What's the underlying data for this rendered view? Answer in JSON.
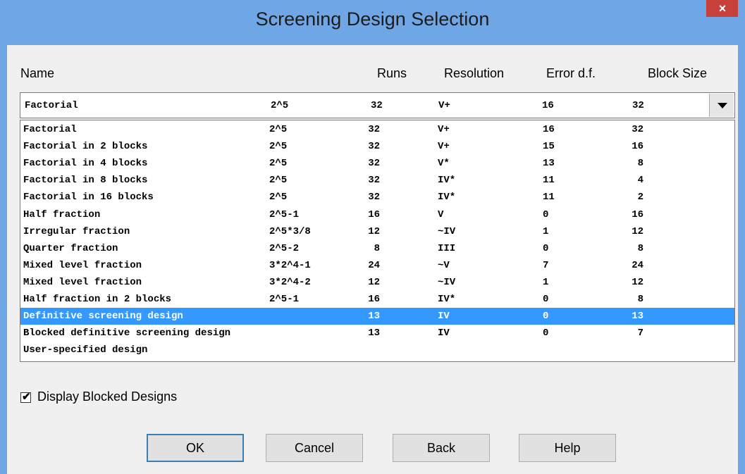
{
  "window": {
    "title": "Screening Design Selection",
    "close_label": "×"
  },
  "headers": {
    "name": "Name",
    "runs": "Runs",
    "resolution": "Resolution",
    "error_df": "Error d.f.",
    "block_size": "Block Size"
  },
  "combo": {
    "name": "Factorial",
    "design": "2^5",
    "runs": "32",
    "resolution": "V+",
    "error_df": "16",
    "block_size": "32"
  },
  "rows": [
    {
      "name": "Factorial",
      "design": "2^5",
      "runs": "32",
      "resolution": "V+",
      "error_df": "16",
      "block_size": "32"
    },
    {
      "name": "Factorial in 2 blocks",
      "design": "2^5",
      "runs": "32",
      "resolution": "V+",
      "error_df": "15",
      "block_size": "16"
    },
    {
      "name": "Factorial in 4 blocks",
      "design": "2^5",
      "runs": "32",
      "resolution": "V*",
      "error_df": "13",
      "block_size": "8"
    },
    {
      "name": "Factorial in 8 blocks",
      "design": "2^5",
      "runs": "32",
      "resolution": "IV*",
      "error_df": "11",
      "block_size": "4"
    },
    {
      "name": "Factorial in 16 blocks",
      "design": "2^5",
      "runs": "32",
      "resolution": "IV*",
      "error_df": "11",
      "block_size": "2"
    },
    {
      "name": "Half fraction",
      "design": "2^5-1",
      "runs": "16",
      "resolution": "V",
      "error_df": "0",
      "block_size": "16"
    },
    {
      "name": "Irregular fraction",
      "design": "2^5*3/8",
      "runs": "12",
      "resolution": "~IV",
      "error_df": "1",
      "block_size": "12"
    },
    {
      "name": "Quarter fraction",
      "design": "2^5-2",
      "runs": "8",
      "resolution": "III",
      "error_df": "0",
      "block_size": "8"
    },
    {
      "name": "Mixed level fraction",
      "design": "3*2^4-1",
      "runs": "24",
      "resolution": "~V",
      "error_df": "7",
      "block_size": "24"
    },
    {
      "name": "Mixed level fraction",
      "design": "3*2^4-2",
      "runs": "12",
      "resolution": "~IV",
      "error_df": "1",
      "block_size": "12"
    },
    {
      "name": "Half fraction in 2 blocks",
      "design": "2^5-1",
      "runs": "16",
      "resolution": "IV*",
      "error_df": "0",
      "block_size": "8"
    },
    {
      "name": "Definitive screening design",
      "design": "",
      "runs": "13",
      "resolution": "IV",
      "error_df": "0",
      "block_size": "13",
      "selected": true
    },
    {
      "name": "Blocked definitive screening design",
      "design": "",
      "runs": "13",
      "resolution": "IV",
      "error_df": "0",
      "block_size": "7"
    },
    {
      "name": "User-specified design",
      "design": "",
      "runs": "",
      "resolution": "",
      "error_df": "",
      "block_size": ""
    }
  ],
  "checkbox": {
    "label": "Display Blocked Designs",
    "checked": true
  },
  "buttons": {
    "ok": "OK",
    "cancel": "Cancel",
    "back": "Back",
    "help": "Help"
  },
  "colors": {
    "titlebar": "#6fa6e6",
    "selection": "#3399ff",
    "close": "#c7403a"
  }
}
